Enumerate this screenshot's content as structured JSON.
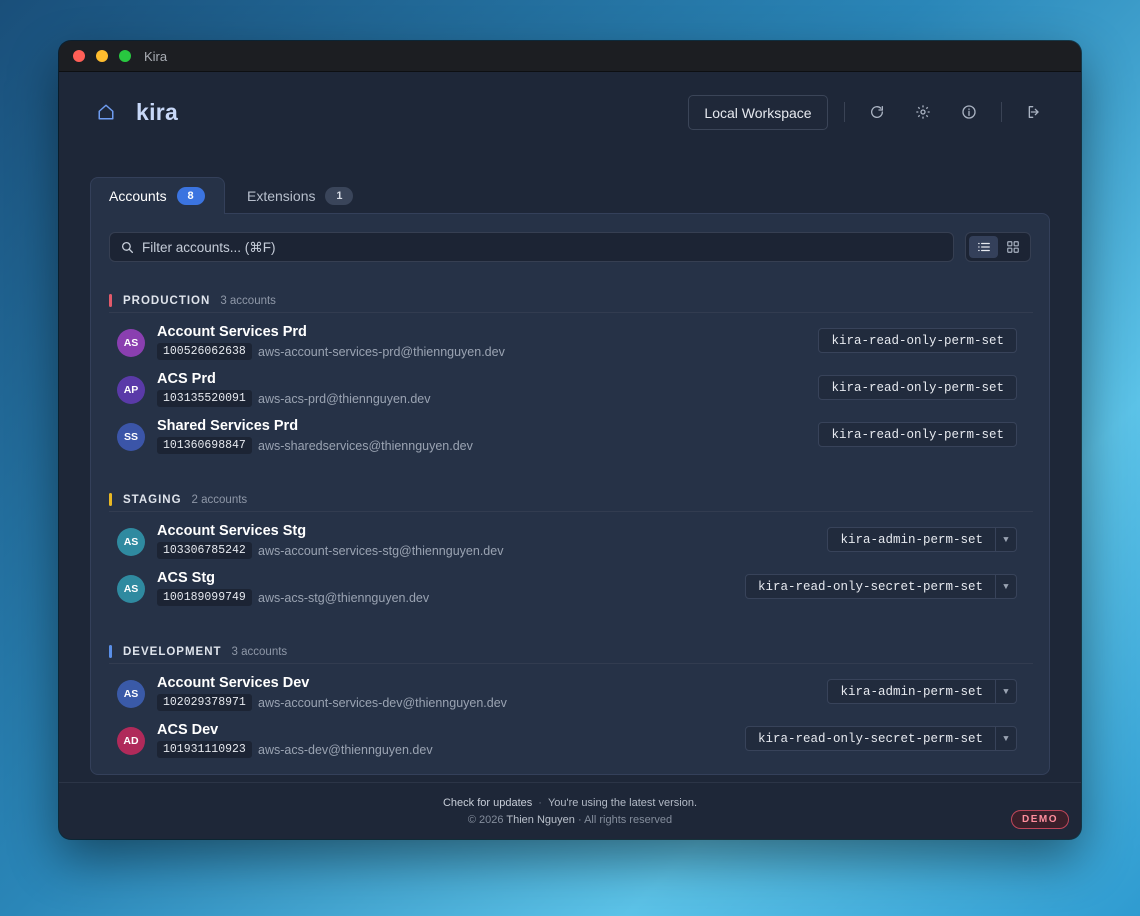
{
  "window": {
    "title": "Kira"
  },
  "header": {
    "brand": "kira",
    "workspace_button": "Local Workspace",
    "icons": [
      "home-icon",
      "refresh-icon",
      "settings-icon",
      "info-icon",
      "logout-icon"
    ]
  },
  "tabs": [
    {
      "label": "Accounts",
      "count": "8",
      "active": true
    },
    {
      "label": "Extensions",
      "count": "1",
      "active": false
    }
  ],
  "search": {
    "placeholder": "Filter accounts... (⌘F)",
    "value": ""
  },
  "view_toggle": {
    "selected": "list",
    "options": [
      "list",
      "grid"
    ]
  },
  "groups": [
    {
      "name": "PRODUCTION",
      "count_label": "3 accounts",
      "color": "#e25a6a",
      "accounts": [
        {
          "initials": "AS",
          "avatar_color": "#8a3fb0",
          "name": "Account Services Prd",
          "id": "100526062638",
          "email": "aws-account-services-prd@thiennguyen.dev",
          "perm_set": "kira-read-only-perm-set",
          "dropdown": false
        },
        {
          "initials": "AP",
          "avatar_color": "#5a3aa8",
          "name": "ACS Prd",
          "id": "103135520091",
          "email": "aws-acs-prd@thiennguyen.dev",
          "perm_set": "kira-read-only-perm-set",
          "dropdown": false
        },
        {
          "initials": "SS",
          "avatar_color": "#3b55a8",
          "name": "Shared Services Prd",
          "id": "101360698847",
          "email": "aws-sharedservices@thiennguyen.dev",
          "perm_set": "kira-read-only-perm-set",
          "dropdown": false
        }
      ]
    },
    {
      "name": "STAGING",
      "count_label": "2 accounts",
      "color": "#e9b824",
      "accounts": [
        {
          "initials": "AS",
          "avatar_color": "#2f8aa0",
          "name": "Account Services Stg",
          "id": "103306785242",
          "email": "aws-account-services-stg@thiennguyen.dev",
          "perm_set": "kira-admin-perm-set",
          "dropdown": true
        },
        {
          "initials": "AS",
          "avatar_color": "#2f8aa0",
          "name": "ACS Stg",
          "id": "100189099749",
          "email": "aws-acs-stg@thiennguyen.dev",
          "perm_set": "kira-read-only-secret-perm-set",
          "dropdown": true
        }
      ]
    },
    {
      "name": "DEVELOPMENT",
      "count_label": "3 accounts",
      "color": "#5a8fe8",
      "accounts": [
        {
          "initials": "AS",
          "avatar_color": "#3a5aa8",
          "name": "Account Services Dev",
          "id": "102029378971",
          "email": "aws-account-services-dev@thiennguyen.dev",
          "perm_set": "kira-admin-perm-set",
          "dropdown": true
        },
        {
          "initials": "AD",
          "avatar_color": "#b02a5a",
          "name": "ACS Dev",
          "id": "101931110923",
          "email": "aws-acs-dev@thiennguyen.dev",
          "perm_set": "kira-read-only-secret-perm-set",
          "dropdown": true
        }
      ]
    }
  ],
  "footer": {
    "check_updates": "Check for updates",
    "separator": "·",
    "status": "You're using the latest version.",
    "copyright_prefix": "© 2026",
    "author": "Thien Nguyen",
    "rights": "· All rights reserved",
    "demo_badge": "DEMO"
  }
}
